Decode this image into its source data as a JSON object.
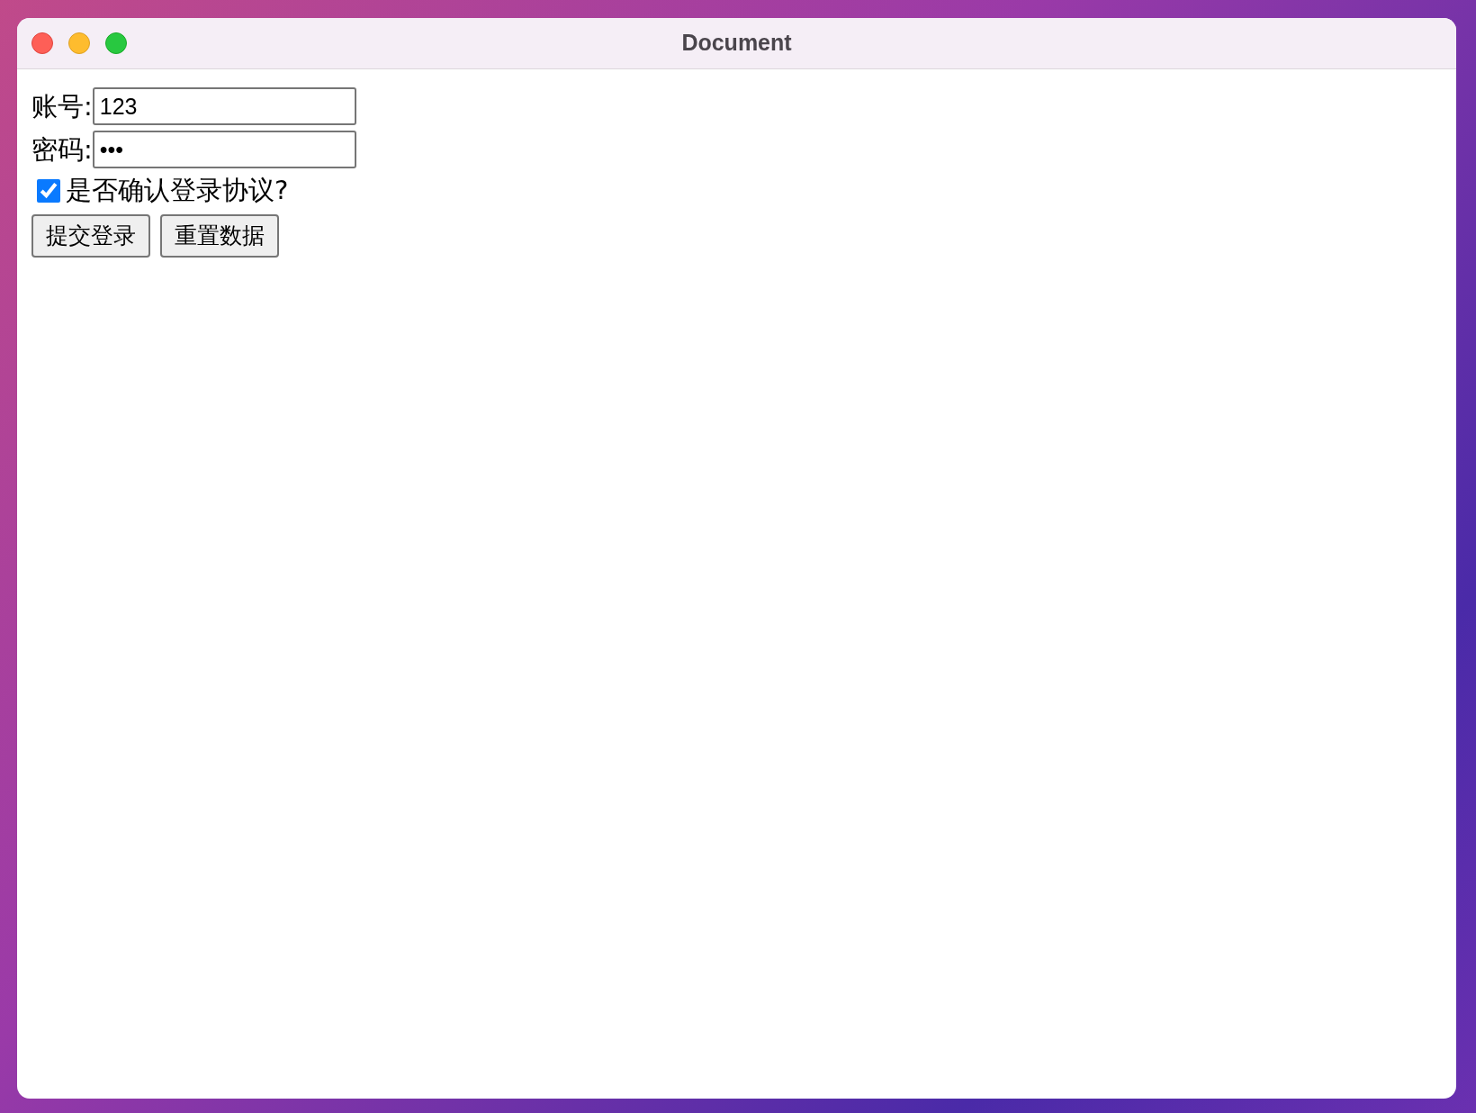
{
  "window": {
    "title": "Document"
  },
  "account": {
    "label": "账号:",
    "value": "123"
  },
  "password": {
    "label": "密码:",
    "value": "•••"
  },
  "agreement": {
    "label": "是否确认登录协议?",
    "checked": true
  },
  "buttons": [
    "提交登录",
    "重置数据"
  ]
}
